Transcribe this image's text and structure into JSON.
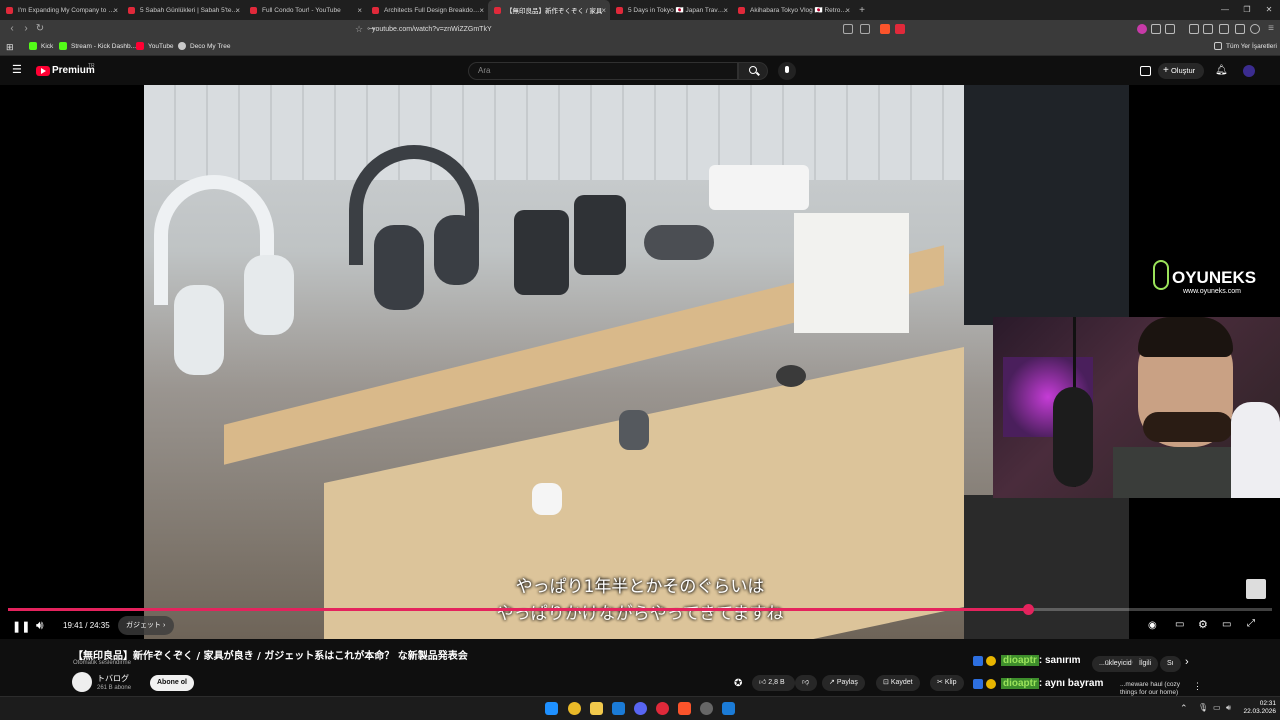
{
  "browser": {
    "tabs": [
      {
        "title": "I'm Expanding My Company to New",
        "active": false
      },
      {
        "title": "5 Sabah Günlükleri | Sabah 5'te uyan",
        "active": false
      },
      {
        "title": "Full Condo Tour! - YouTube",
        "active": false
      },
      {
        "title": "Architects Full Design Breakdown of",
        "active": false
      },
      {
        "title": "【無印良品】新作ぞくぞく / 家具",
        "active": true
      },
      {
        "title": "5 Days in Tokyo 🇯🇵 Japan Travel Vlog",
        "active": false
      },
      {
        "title": "Akihabara Tokyo Vlog 🇯🇵 Retro Game",
        "active": false
      }
    ],
    "new_tab": "+",
    "url": "youtube.com/watch?v=znWiZZGmTkY",
    "bookmarks": [
      {
        "label": "Kick",
        "color": "#53fc18"
      },
      {
        "label": "Stream - Kick Dashb...",
        "color": "#53fc18"
      },
      {
        "label": "YouTube",
        "color": "#ff0033"
      },
      {
        "label": "Deco My Tree",
        "color": "#c8c8c8"
      }
    ],
    "all_bookmarks": "Tüm Yer İşaretleri"
  },
  "youtube": {
    "logo": "Premium",
    "logo_badge": "TR",
    "search_placeholder": "Ara",
    "create_label": "Oluştur"
  },
  "player": {
    "subtitle_line1": "やっぱり1年半とかそのぐらいは",
    "subtitle_line2": "やっぱりかけながらやってきてますね",
    "time": "19:41 / 24:35",
    "chapter": "ガジェット",
    "progress": 0.807,
    "overlay_brand": "OYUNEKS",
    "overlay_url": "www.oyuneks.com"
  },
  "video": {
    "title": "【無印良品】新作ぞくぞく / 家具が良き / ガジェット系はこれが本命？ な新製品発表会",
    "voice_tag": "Otomatik seslendirme",
    "channel": "トバログ",
    "subscribers": "261 B abone",
    "subscribe": "Abone ol",
    "likes": "2,8 B",
    "share": "Paylaş",
    "save": "Kaydet",
    "clip": "Klip"
  },
  "sidebar": {
    "chips": [
      "...ükleyiciden",
      "İlgili",
      "Sı"
    ],
    "next_title": "...meware haul (cozy things for our home)"
  },
  "chat": [
    {
      "user": "dioaptr",
      "message": ": sanırım"
    },
    {
      "user": "dioaptr",
      "message": ": aynı bayram"
    }
  ],
  "taskbar": {
    "time": "02:31",
    "date": "22.03.2026"
  },
  "colors": {
    "progress": "#e4235d",
    "yt_red": "#ff0033",
    "kick_green": "#53fc18"
  }
}
